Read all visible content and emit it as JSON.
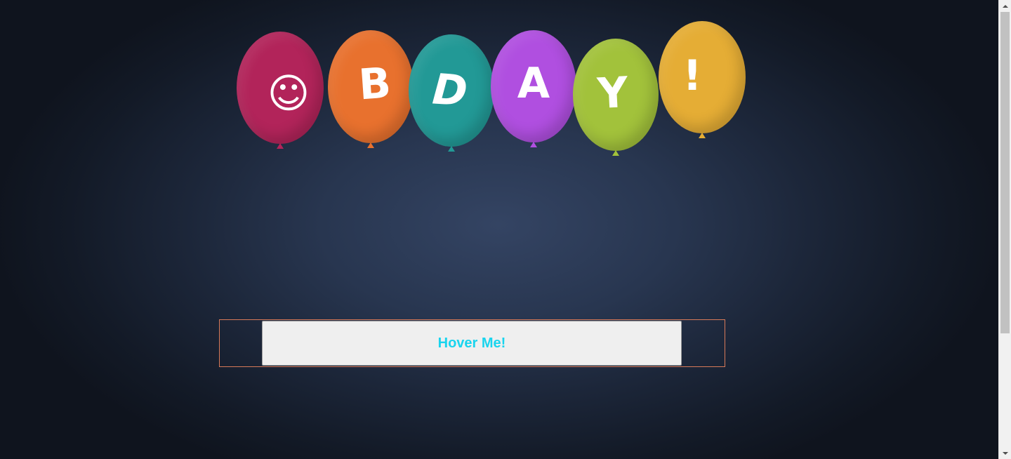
{
  "balloons": [
    {
      "char": "☺",
      "color": "#b2245a",
      "icon": "smiley-icon"
    },
    {
      "char": "B",
      "color": "#e8712e"
    },
    {
      "char": "D",
      "color": "#229996"
    },
    {
      "char": "A",
      "color": "#b04fe0"
    },
    {
      "char": "Y",
      "color": "#a2c23b"
    },
    {
      "char": "!",
      "color": "#e5ad35"
    }
  ],
  "hover_button": {
    "label": "Hover Me!",
    "text_color": "#19d4ee",
    "frame_color": "#d87a59"
  },
  "scrollbar": {
    "up_icon": "scroll-up-arrow-icon",
    "down_icon": "scroll-down-arrow-icon"
  }
}
